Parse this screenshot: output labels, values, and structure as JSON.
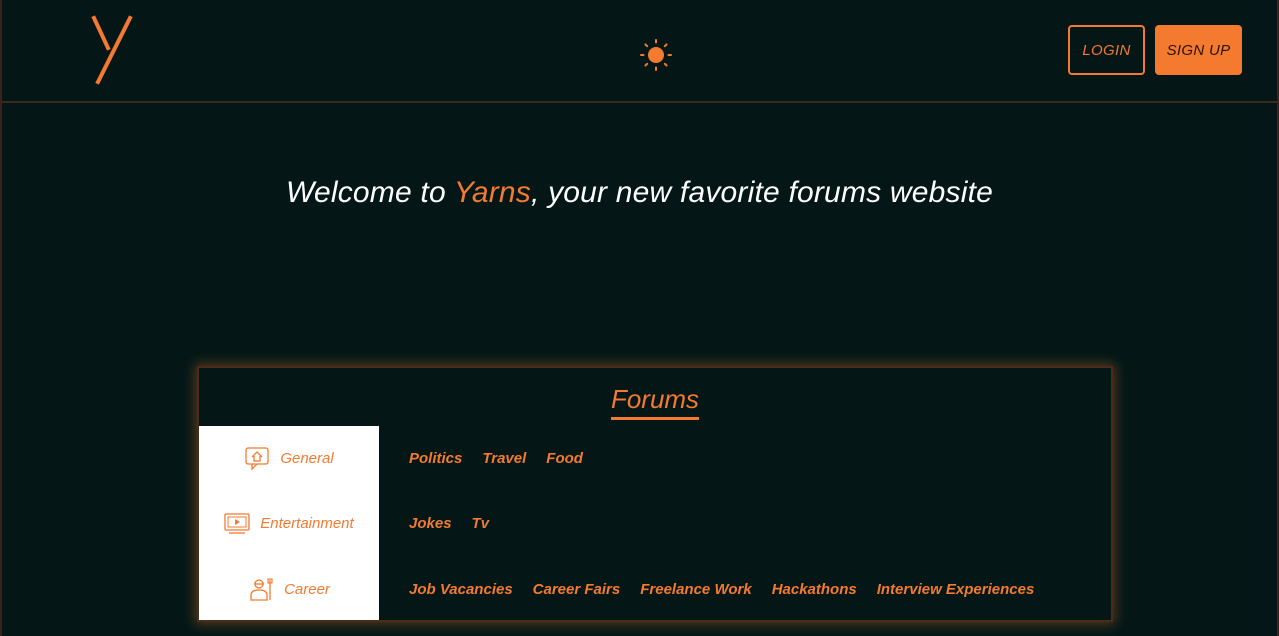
{
  "header": {
    "logo_icon": "yarns-y-logo-icon",
    "theme_icon": "sun-icon",
    "login_label": "LOGIN",
    "signup_label": "SIGN UP"
  },
  "hero": {
    "prefix": "Welcome to ",
    "brand": "Yarns",
    "suffix": ", your new favorite forums website"
  },
  "forums": {
    "title": "Forums",
    "categories": [
      {
        "label": "General",
        "icon": "home-chat-icon",
        "topics": [
          "Politics",
          "Travel",
          "Food"
        ]
      },
      {
        "label": "Entertainment",
        "icon": "tv-icon",
        "topics": [
          "Jokes",
          "Tv"
        ]
      },
      {
        "label": "Career",
        "icon": "worker-icon",
        "topics": [
          "Job Vacancies",
          "Career Fairs",
          "Freelance Work",
          "Hackathons",
          "Interview Experiences"
        ]
      }
    ]
  },
  "colors": {
    "background": "#041716",
    "accent": "#f47a30",
    "text": "#ffffff"
  }
}
